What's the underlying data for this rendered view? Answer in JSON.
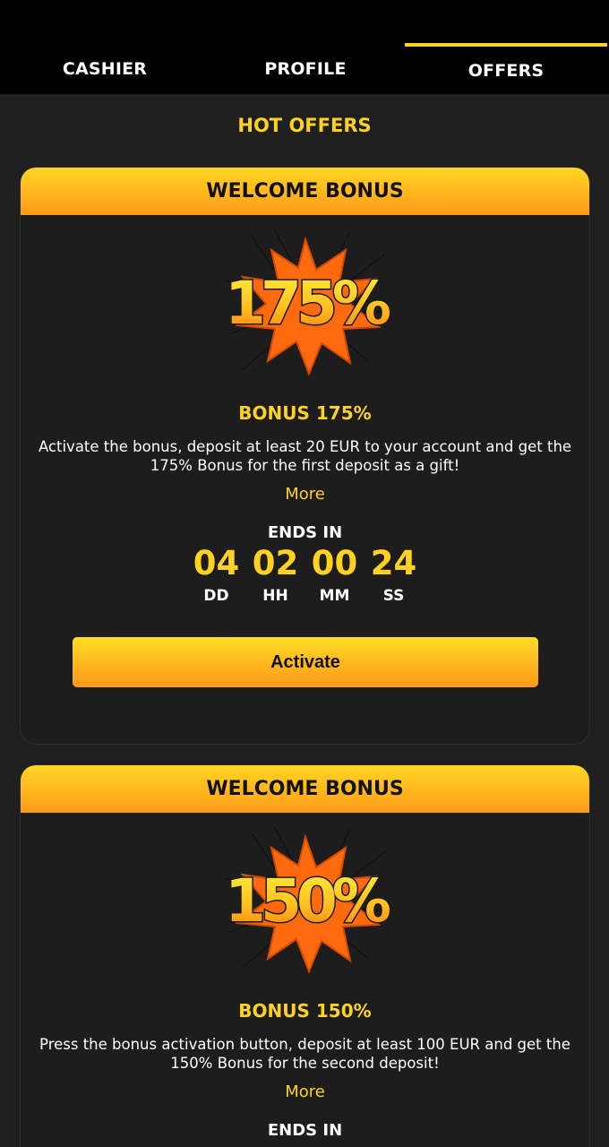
{
  "tabs": {
    "cashier": "CASHIER",
    "profile": "PROFILE",
    "offers": "OFFERS",
    "active": "offers"
  },
  "section_title": "HOT OFFERS",
  "offers": [
    {
      "header": "WELCOME BONUS",
      "badge_text": "175%",
      "title": "BONUS 175%",
      "description": "Activate the bonus, deposit at least 20 EUR to your account and get the 175% Bonus for the first deposit as a gift!",
      "more": "More",
      "ends_label": "ENDS IN",
      "timer": {
        "dd": "04",
        "hh": "02",
        "mm": "00",
        "ss": "24",
        "dd_label": "DD",
        "hh_label": "HH",
        "mm_label": "MM",
        "ss_label": "SS"
      },
      "button": "Activate"
    },
    {
      "header": "WELCOME BONUS",
      "badge_text": "150%",
      "title": "BONUS 150%",
      "description": "Press the bonus activation button, deposit at least 100 EUR and get the 150% Bonus for the second deposit!",
      "more": "More",
      "ends_label": "ENDS IN"
    }
  ],
  "colors": {
    "accent": "#ffd21f",
    "orange": "#ff9a1a",
    "background": "#1f1f1f",
    "topbar": "#000000"
  }
}
